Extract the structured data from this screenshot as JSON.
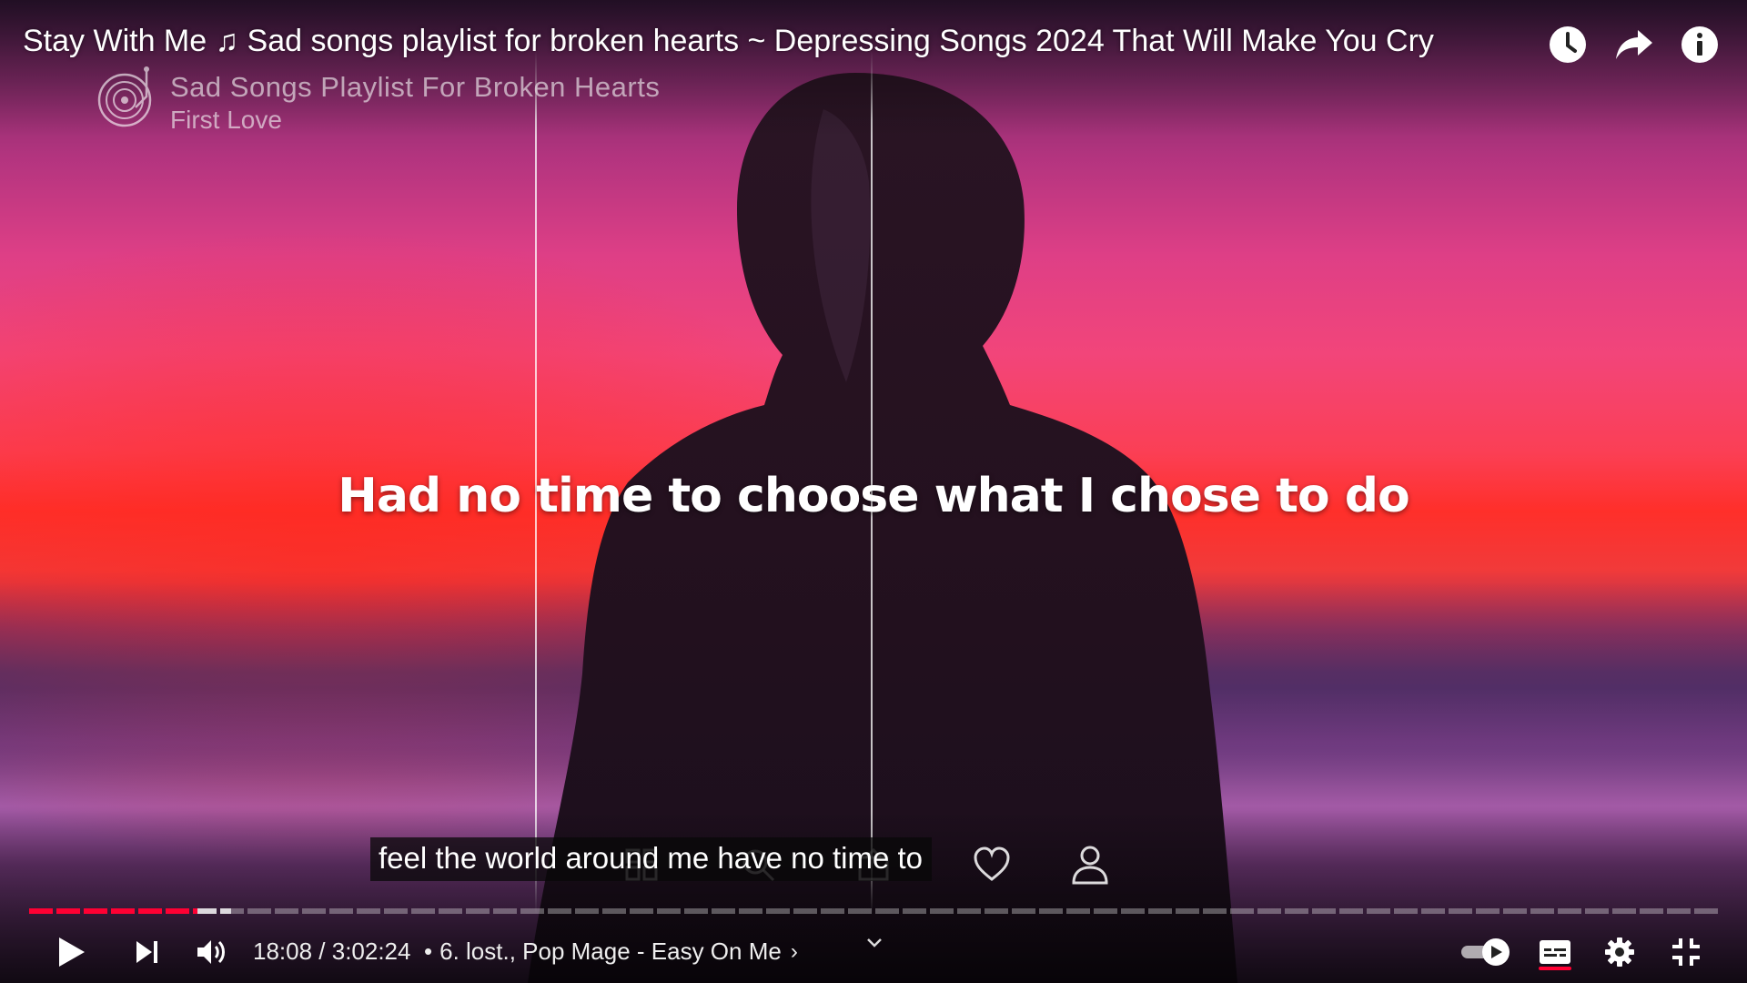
{
  "video": {
    "title": "Stay With Me ♫ Sad songs playlist for broken hearts ~ Depressing Songs 2024 That Will Make You Cry",
    "lyric": "Had no time to choose what I chose to do",
    "caption": "feel the world around me have no time to"
  },
  "channel": {
    "name": "Sad Songs Playlist For Broken Hearts",
    "subtitle": "First Love"
  },
  "top_actions": {
    "watch_later_icon": "clock-icon",
    "share_icon": "share-arrow-icon",
    "info_icon": "info-icon"
  },
  "ghost_icons": [
    "grid-icon",
    "search-icon",
    "home-icon",
    "heart-icon",
    "user-icon"
  ],
  "progress": {
    "played_fraction": 0.0996,
    "current_time": "18:08",
    "duration": "3:02:24"
  },
  "controls": {
    "time_display": "18:08 / 3:02:24",
    "separator": "•",
    "chapter": "6. lost., Pop Mage - Easy On Me",
    "chapter_chevron": "›",
    "play_icon": "play-icon",
    "next_icon": "skip-next-icon",
    "volume_icon": "volume-icon",
    "autoplay_icon": "autoplay-toggle-icon",
    "subtitles_icon": "subtitles-icon",
    "settings_icon": "gear-icon",
    "exit_fullscreen_icon": "exit-fullscreen-icon"
  },
  "colors": {
    "accent": "#ff0033",
    "text": "#ffffff"
  }
}
